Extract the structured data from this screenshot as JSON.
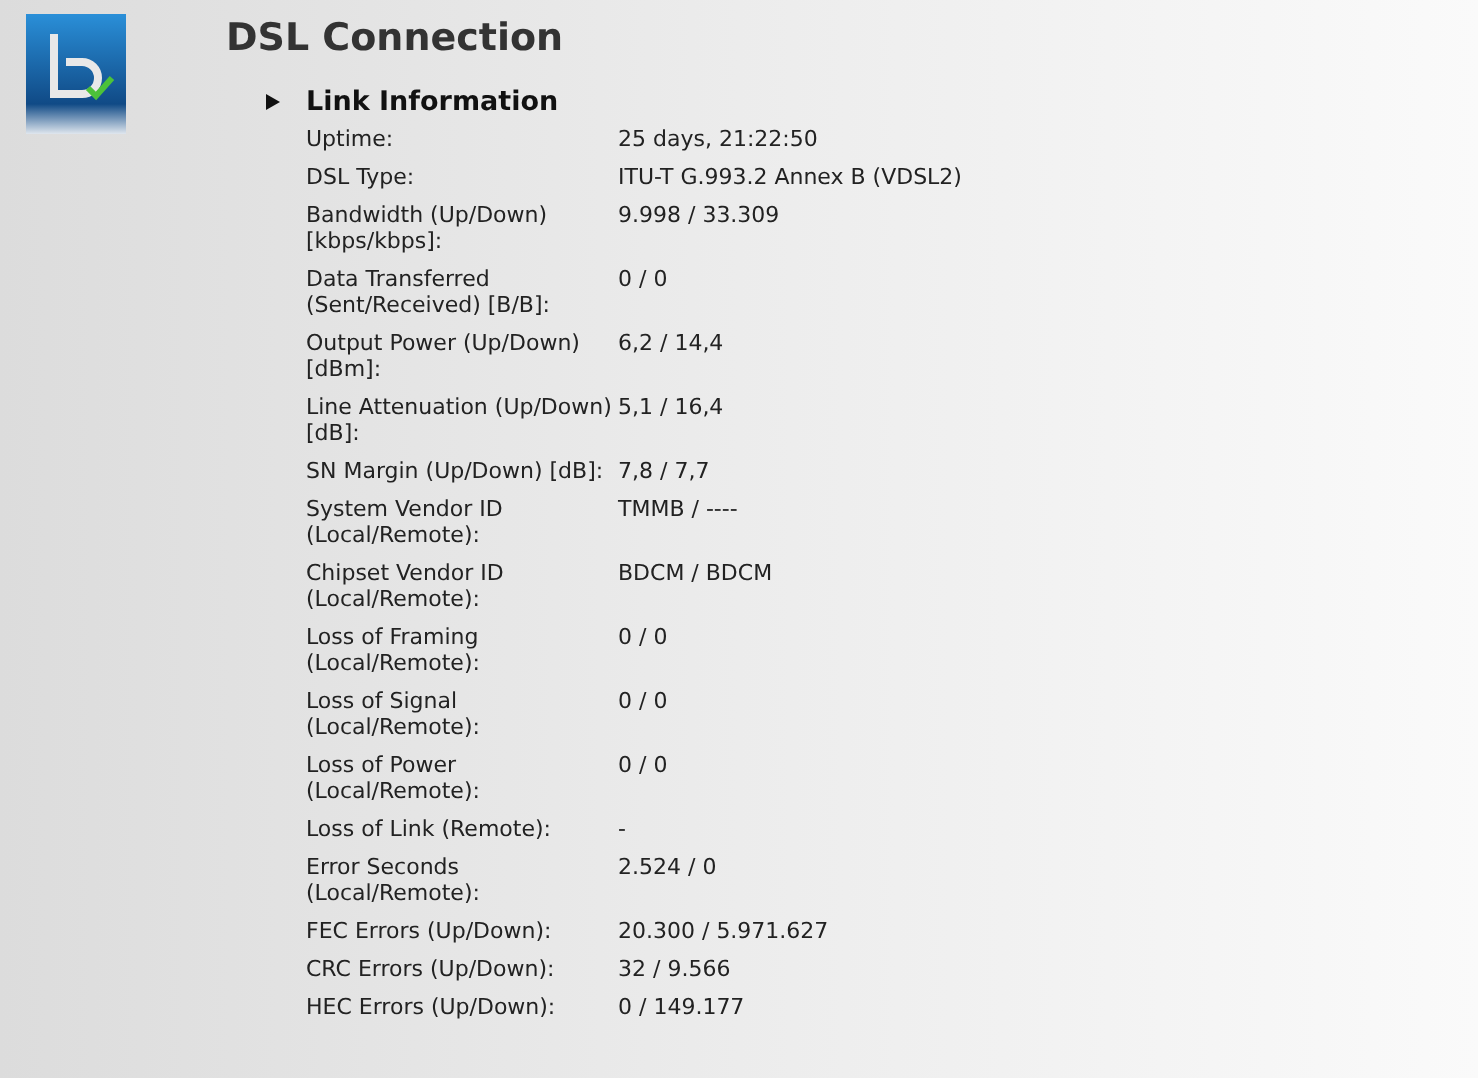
{
  "page_title": "DSL Connection",
  "section": {
    "title": "Link Information",
    "expanded": true
  },
  "rows": [
    {
      "label": "Uptime:",
      "value": "25 days, 21:22:50"
    },
    {
      "label": "DSL Type:",
      "value": "ITU-T G.993.2 Annex B (VDSL2)"
    },
    {
      "label": "Bandwidth (Up/Down) [kbps/kbps]:",
      "value": "9.998 / 33.309"
    },
    {
      "label": "Data Transferred (Sent/Received) [B/B]:",
      "value": "0 / 0"
    },
    {
      "label": "Output Power (Up/Down) [dBm]:",
      "value": "6,2 / 14,4"
    },
    {
      "label": "Line Attenuation (Up/Down) [dB]:",
      "value": "5,1 / 16,4"
    },
    {
      "label": "SN Margin (Up/Down) [dB]:",
      "value": "7,8 / 7,7"
    },
    {
      "label": "System Vendor ID (Local/Remote):",
      "value": "TMMB / ----"
    },
    {
      "label": "Chipset Vendor ID (Local/Remote):",
      "value": "BDCM / BDCM"
    },
    {
      "label": "Loss of Framing (Local/Remote):",
      "value": "0 / 0"
    },
    {
      "label": "Loss of Signal (Local/Remote):",
      "value": "0 / 0"
    },
    {
      "label": "Loss of Power (Local/Remote):",
      "value": "0 / 0"
    },
    {
      "label": "Loss of Link (Remote):",
      "value": "-"
    },
    {
      "label": "Error Seconds (Local/Remote):",
      "value": "2.524 / 0"
    },
    {
      "label": "FEC Errors (Up/Down):",
      "value": "20.300 / 5.971.627"
    },
    {
      "label": "CRC Errors (Up/Down):",
      "value": "32 / 9.566"
    },
    {
      "label": "HEC Errors (Up/Down):",
      "value": "0 / 149.177"
    }
  ]
}
